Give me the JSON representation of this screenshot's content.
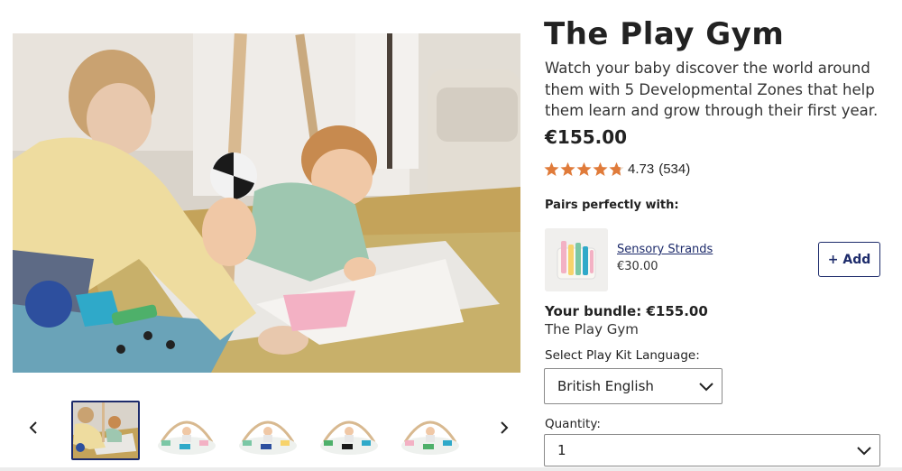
{
  "product": {
    "title": "The Play Gym",
    "description": "Watch your baby discover the world around them with 5 Developmental Zones that help them learn and grow through their first year.",
    "price": "€155.00",
    "rating": {
      "value": "4.73",
      "count": "(534)",
      "stars_filled": 4.73,
      "stars_total": 5
    }
  },
  "gallery": {
    "hero_image": "mother and baby on play gym mat",
    "prev_icon": "chevron-left-icon",
    "next_icon": "chevron-right-icon",
    "thumbnails": [
      {
        "name": "mother-and-baby-photo",
        "selected": true
      },
      {
        "name": "play-gym-photo",
        "selected": false
      },
      {
        "name": "play-gym-photo",
        "selected": false
      },
      {
        "name": "play-gym-photo",
        "selected": false
      },
      {
        "name": "play-gym-photo",
        "selected": false
      }
    ]
  },
  "pairs": {
    "label": "Pairs perfectly with:",
    "item": {
      "name": "Sensory Strands",
      "price": "€30.00",
      "add_label": "+ Add"
    }
  },
  "bundle": {
    "label": "Your bundle: €155.00",
    "item": "The Play Gym"
  },
  "options": {
    "language_label": "Select Play Kit Language:",
    "language_value": "British English",
    "quantity_label": "Quantity:",
    "quantity_value": "1"
  },
  "colors": {
    "accent": "#1d2b6b",
    "star": "#e07b3a",
    "border": "#8a8a8a"
  }
}
